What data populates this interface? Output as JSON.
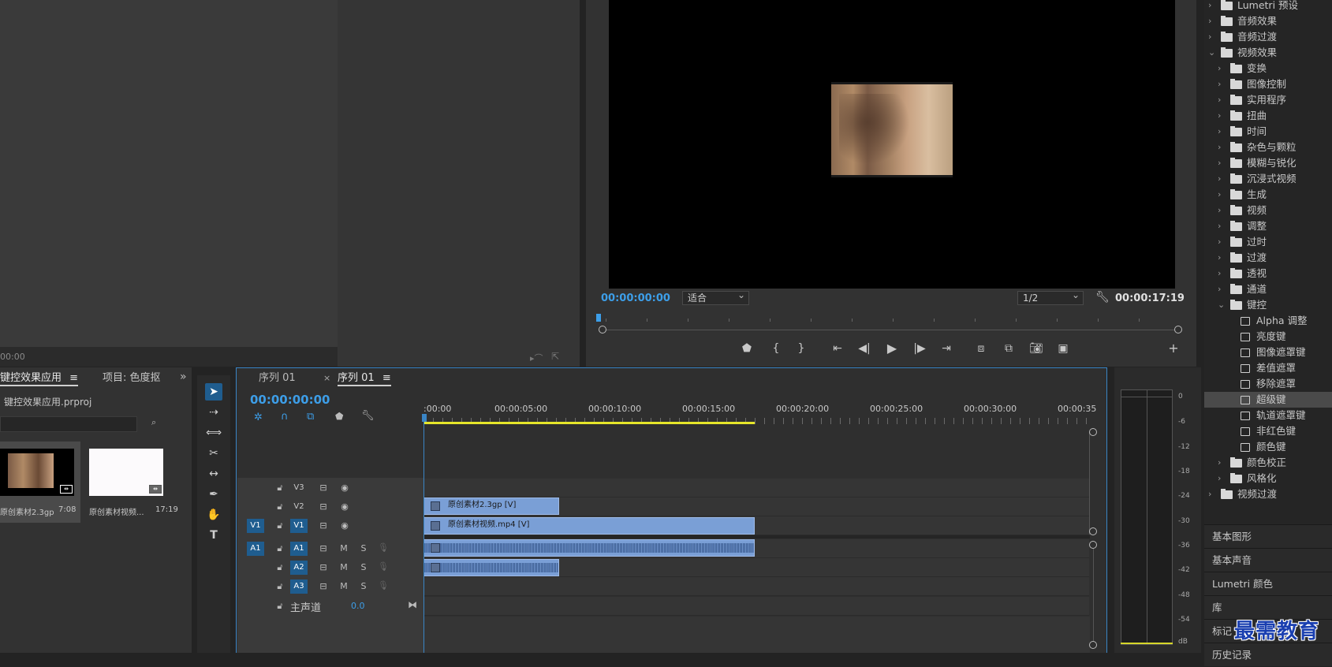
{
  "source_monitor": {
    "timecode": "00:00"
  },
  "program_monitor": {
    "timecode_current": "00:00:00:00",
    "fit_select": "适合",
    "resolution_select": "1/2",
    "timecode_duration": "00:00:17:19"
  },
  "effects": {
    "items": [
      {
        "label": "Lumetri 预设",
        "level": 0,
        "type": "folder",
        "expanded": false
      },
      {
        "label": "音频效果",
        "level": 0,
        "type": "folder",
        "expanded": false
      },
      {
        "label": "音频过渡",
        "level": 0,
        "type": "folder",
        "expanded": false
      },
      {
        "label": "视频效果",
        "level": 0,
        "type": "folder",
        "expanded": true
      },
      {
        "label": "变换",
        "level": 1,
        "type": "folder",
        "expanded": false
      },
      {
        "label": "图像控制",
        "level": 1,
        "type": "folder",
        "expanded": false
      },
      {
        "label": "实用程序",
        "level": 1,
        "type": "folder",
        "expanded": false
      },
      {
        "label": "扭曲",
        "level": 1,
        "type": "folder",
        "expanded": false
      },
      {
        "label": "时间",
        "level": 1,
        "type": "folder",
        "expanded": false
      },
      {
        "label": "杂色与颗粒",
        "level": 1,
        "type": "folder",
        "expanded": false
      },
      {
        "label": "模糊与锐化",
        "level": 1,
        "type": "folder",
        "expanded": false
      },
      {
        "label": "沉浸式视频",
        "level": 1,
        "type": "folder",
        "expanded": false
      },
      {
        "label": "生成",
        "level": 1,
        "type": "folder",
        "expanded": false
      },
      {
        "label": "视频",
        "level": 1,
        "type": "folder",
        "expanded": false
      },
      {
        "label": "调整",
        "level": 1,
        "type": "folder",
        "expanded": false
      },
      {
        "label": "过时",
        "level": 1,
        "type": "folder",
        "expanded": false
      },
      {
        "label": "过渡",
        "level": 1,
        "type": "folder",
        "expanded": false
      },
      {
        "label": "透视",
        "level": 1,
        "type": "folder",
        "expanded": false
      },
      {
        "label": "通道",
        "level": 1,
        "type": "folder",
        "expanded": false
      },
      {
        "label": "键控",
        "level": 1,
        "type": "folder",
        "expanded": true
      },
      {
        "label": "Alpha 调整",
        "level": 2,
        "type": "effect"
      },
      {
        "label": "亮度键",
        "level": 2,
        "type": "effect"
      },
      {
        "label": "图像遮罩键",
        "level": 2,
        "type": "effect"
      },
      {
        "label": "差值遮罩",
        "level": 2,
        "type": "effect"
      },
      {
        "label": "移除遮罩",
        "level": 2,
        "type": "effect"
      },
      {
        "label": "超级键",
        "level": 2,
        "type": "effect",
        "selected": true
      },
      {
        "label": "轨道遮罩键",
        "level": 2,
        "type": "effect"
      },
      {
        "label": "非红色键",
        "level": 2,
        "type": "effect"
      },
      {
        "label": "颜色键",
        "level": 2,
        "type": "effect"
      },
      {
        "label": "颜色校正",
        "level": 1,
        "type": "folder",
        "expanded": false
      },
      {
        "label": "风格化",
        "level": 1,
        "type": "folder",
        "expanded": false
      },
      {
        "label": "视频过渡",
        "level": 0,
        "type": "folder",
        "expanded": false
      }
    ],
    "sections": [
      "基本图形",
      "基本声音",
      "Lumetri 颜色",
      "库",
      "标记",
      "历史记录"
    ]
  },
  "project": {
    "tab_active": "键控效果应用",
    "tab_other": "项目: 色度抠",
    "filename": "键控效果应用.prproj",
    "bins": [
      {
        "name": "原创素材2.3gp",
        "duration": "7:08"
      },
      {
        "name": "原创素材视频...",
        "duration": "17:19"
      }
    ]
  },
  "timeline": {
    "tabs": [
      "序列 01",
      "序列 01"
    ],
    "timecode": "00:00:00:00",
    "ruler_labels": [
      ":00:00",
      "00:00:05:00",
      "00:00:10:00",
      "00:00:15:00",
      "00:00:20:00",
      "00:00:25:00",
      "00:00:30:00",
      "00:00:35"
    ],
    "video_tracks": [
      {
        "name": "V3",
        "source": ""
      },
      {
        "name": "V2",
        "source": ""
      },
      {
        "name": "V1",
        "source": "V1"
      }
    ],
    "audio_tracks": [
      {
        "name": "A1",
        "source": "A1",
        "m": "M",
        "s": "S"
      },
      {
        "name": "A2",
        "source": "",
        "m": "M",
        "s": "S"
      },
      {
        "name": "A3",
        "source": "",
        "m": "M",
        "s": "S"
      }
    ],
    "master": {
      "label": "主声道",
      "value": "0.0"
    },
    "clips": {
      "v2": "原创素材2.3gp [V]",
      "v1": "原创素材视频.mp4 [V]"
    }
  },
  "meter": {
    "scale": [
      "0",
      "-6",
      "-12",
      "-18",
      "-24",
      "-30",
      "-36",
      "-42",
      "-48",
      "-54",
      "dB"
    ]
  },
  "watermark": "最需教育"
}
